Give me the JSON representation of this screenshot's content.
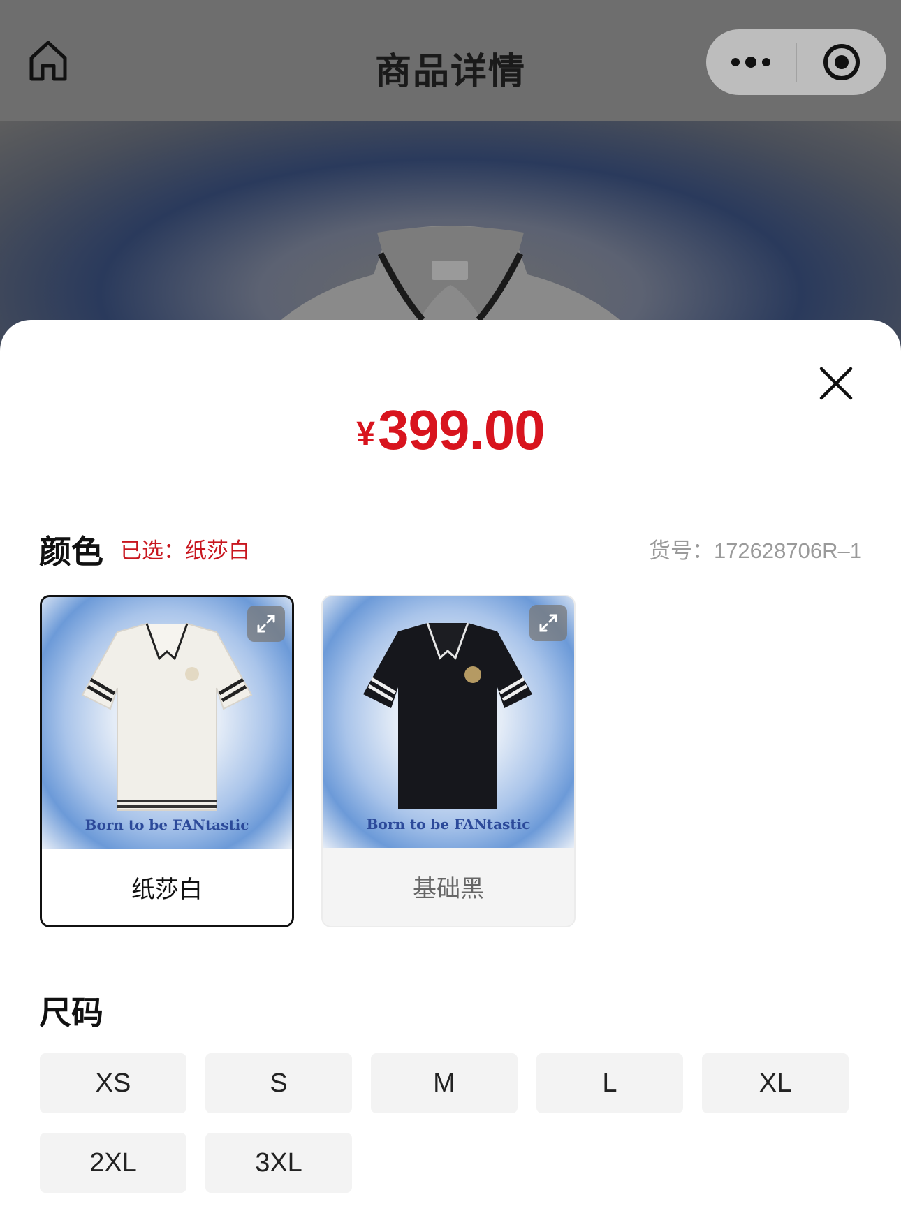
{
  "navbar": {
    "title": "商品详情",
    "home_icon": "home-icon",
    "more_icon": "more-dots-icon",
    "close_icon": "target-icon"
  },
  "sheet": {
    "price_symbol": "¥",
    "price_amount": "399.00",
    "close_icon": "close-icon",
    "color_section": {
      "title": "颜色",
      "selected_text": "已选：纸莎白",
      "sku_text": "货号：172628706R–1"
    },
    "colors": [
      {
        "label": "纸莎白",
        "tagline": "Born to be FANtastic",
        "selected": true,
        "shirt_color": "#f1efe9"
      },
      {
        "label": "基础黑",
        "tagline": "Born to be FANtastic",
        "selected": false,
        "shirt_color": "#16171c"
      }
    ],
    "size_section": {
      "title": "尺码"
    },
    "sizes": [
      "XS",
      "S",
      "M",
      "L",
      "XL",
      "2XL",
      "3XL"
    ]
  },
  "colors": {
    "price": "#d8141e",
    "selected_text": "#c8161e",
    "overlay_nav": "#6e6e6e"
  }
}
